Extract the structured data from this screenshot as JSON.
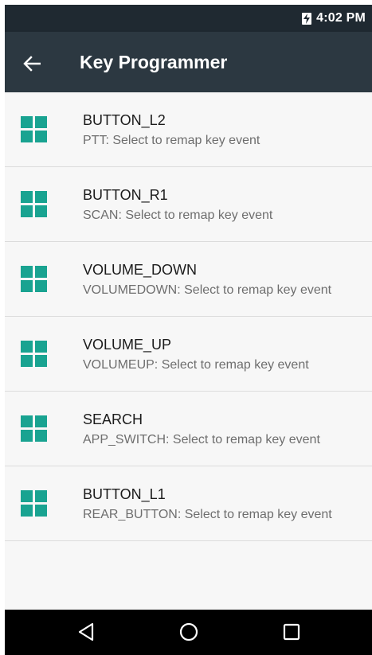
{
  "status_bar": {
    "time": "4:02 PM",
    "battery_icon": "battery-charging-icon"
  },
  "app_bar": {
    "title": "Key Programmer",
    "back_icon": "back-arrow-icon"
  },
  "colors": {
    "status_bar": "#1f2931",
    "app_bar": "#2c3841",
    "accent": "#19a391",
    "nav_bar": "#000000"
  },
  "items": [
    {
      "title": "BUTTON_L2",
      "subtitle": "PTT: Select to remap key event",
      "icon": "grid-icon"
    },
    {
      "title": "BUTTON_R1",
      "subtitle": "SCAN: Select to remap key event",
      "icon": "grid-icon"
    },
    {
      "title": "VOLUME_DOWN",
      "subtitle": "VOLUMEDOWN: Select to remap key event",
      "icon": "grid-icon"
    },
    {
      "title": "VOLUME_UP",
      "subtitle": "VOLUMEUP: Select to remap key event",
      "icon": "grid-icon"
    },
    {
      "title": "SEARCH",
      "subtitle": "APP_SWITCH: Select to remap key event",
      "icon": "grid-icon"
    },
    {
      "title": "BUTTON_L1",
      "subtitle": "REAR_BUTTON: Select to remap key event",
      "icon": "grid-icon"
    }
  ],
  "nav_bar": {
    "buttons": [
      "back-triangle-icon",
      "home-circle-icon",
      "recents-square-icon"
    ]
  }
}
